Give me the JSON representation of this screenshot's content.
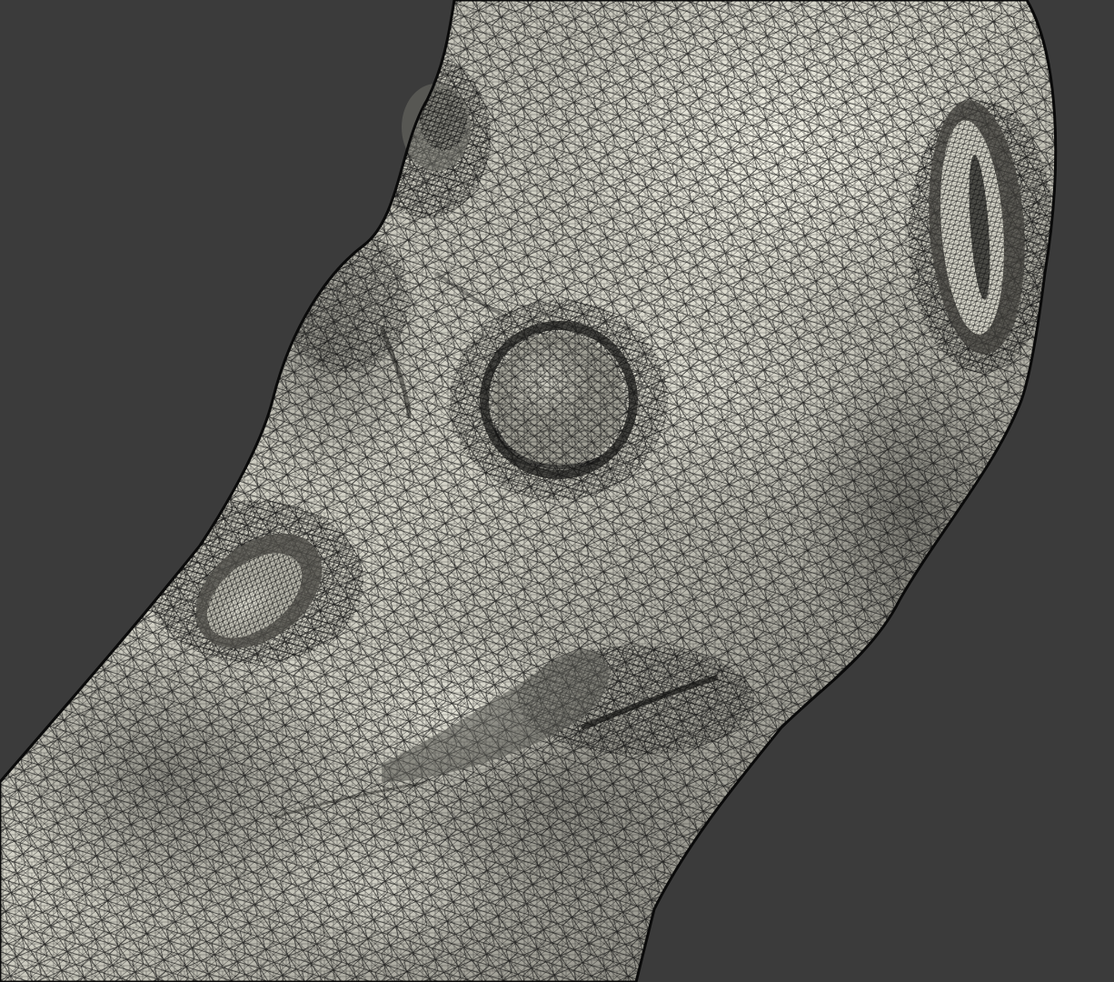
{
  "viewport": {
    "background_color": "#3b3b3b",
    "render_mode": "wireframe-on-shaded",
    "model": {
      "type": "triangulated-surface-mesh",
      "surface_color": "#c9c8bd",
      "highlight_color": "#f3f2e6",
      "shadow_color": "#4a4a45",
      "wire_color": "#111111"
    }
  }
}
